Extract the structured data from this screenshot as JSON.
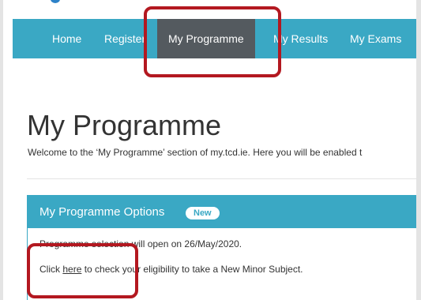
{
  "colors": {
    "nav_bg": "#3aa8c4",
    "nav_active_bg": "#545a5f",
    "highlight_border": "#b31820",
    "text": "#333333"
  },
  "nav": {
    "items": [
      {
        "label": "Home"
      },
      {
        "label": "Register"
      },
      {
        "label": "My Programme",
        "active": true
      },
      {
        "label": "My Results"
      },
      {
        "label": "My Exams"
      }
    ]
  },
  "main": {
    "title": "My Programme",
    "intro": "Welcome to the ‘My Programme’ section of my.tcd.ie. Here you will be enabled t"
  },
  "panel": {
    "title": "My Programme Options",
    "badge": "New",
    "line1": "Programme selection will open on 26/May/2020.",
    "line2_prefix": "Click ",
    "line2_link": "here",
    "line2_suffix": " to check your eligibility to take a New Minor Subject."
  }
}
